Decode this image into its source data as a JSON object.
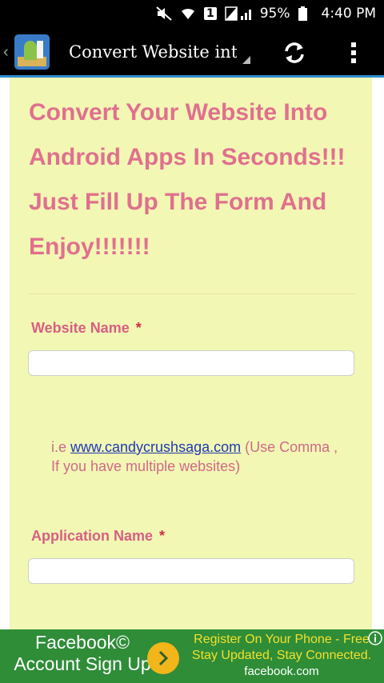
{
  "status_bar": {
    "battery_percent": "95%",
    "time": "4:40 PM",
    "sim_label": "1",
    "icons": [
      "mute-icon",
      "wifi-icon",
      "sim-icon",
      "signal-icon",
      "battery-icon"
    ]
  },
  "action_bar": {
    "title": "Convert Website int..",
    "icons": [
      "app-logo-icon",
      "refresh-icon",
      "overflow-menu-icon"
    ]
  },
  "page": {
    "heading": "Convert Your Website Into Android Apps In Seconds!!! Just Fill Up The Form And Enjoy!!!!!!!"
  },
  "form": {
    "website_name": {
      "label": "Website Name",
      "required_mark": "*",
      "value": ""
    },
    "hint_prefix": "i.e ",
    "hint_link": "www.candycrushsaga.com",
    "hint_suffix": " (Use Comma , If you have multiple websites)",
    "application_name": {
      "label": "Application Name",
      "required_mark": "*",
      "value": ""
    }
  },
  "ad": {
    "left_text": "Facebook© Account Sign Up",
    "right_text": "Register On Your Phone - Free Stay Updated, Stay Connected.",
    "url": "facebook.com"
  },
  "colors": {
    "heading": "#e0708e",
    "content_bg": "#f2f7b4",
    "ad_bg": "#2f8d38",
    "ad_accent": "#f3e02b",
    "link": "#1f3bb3"
  }
}
